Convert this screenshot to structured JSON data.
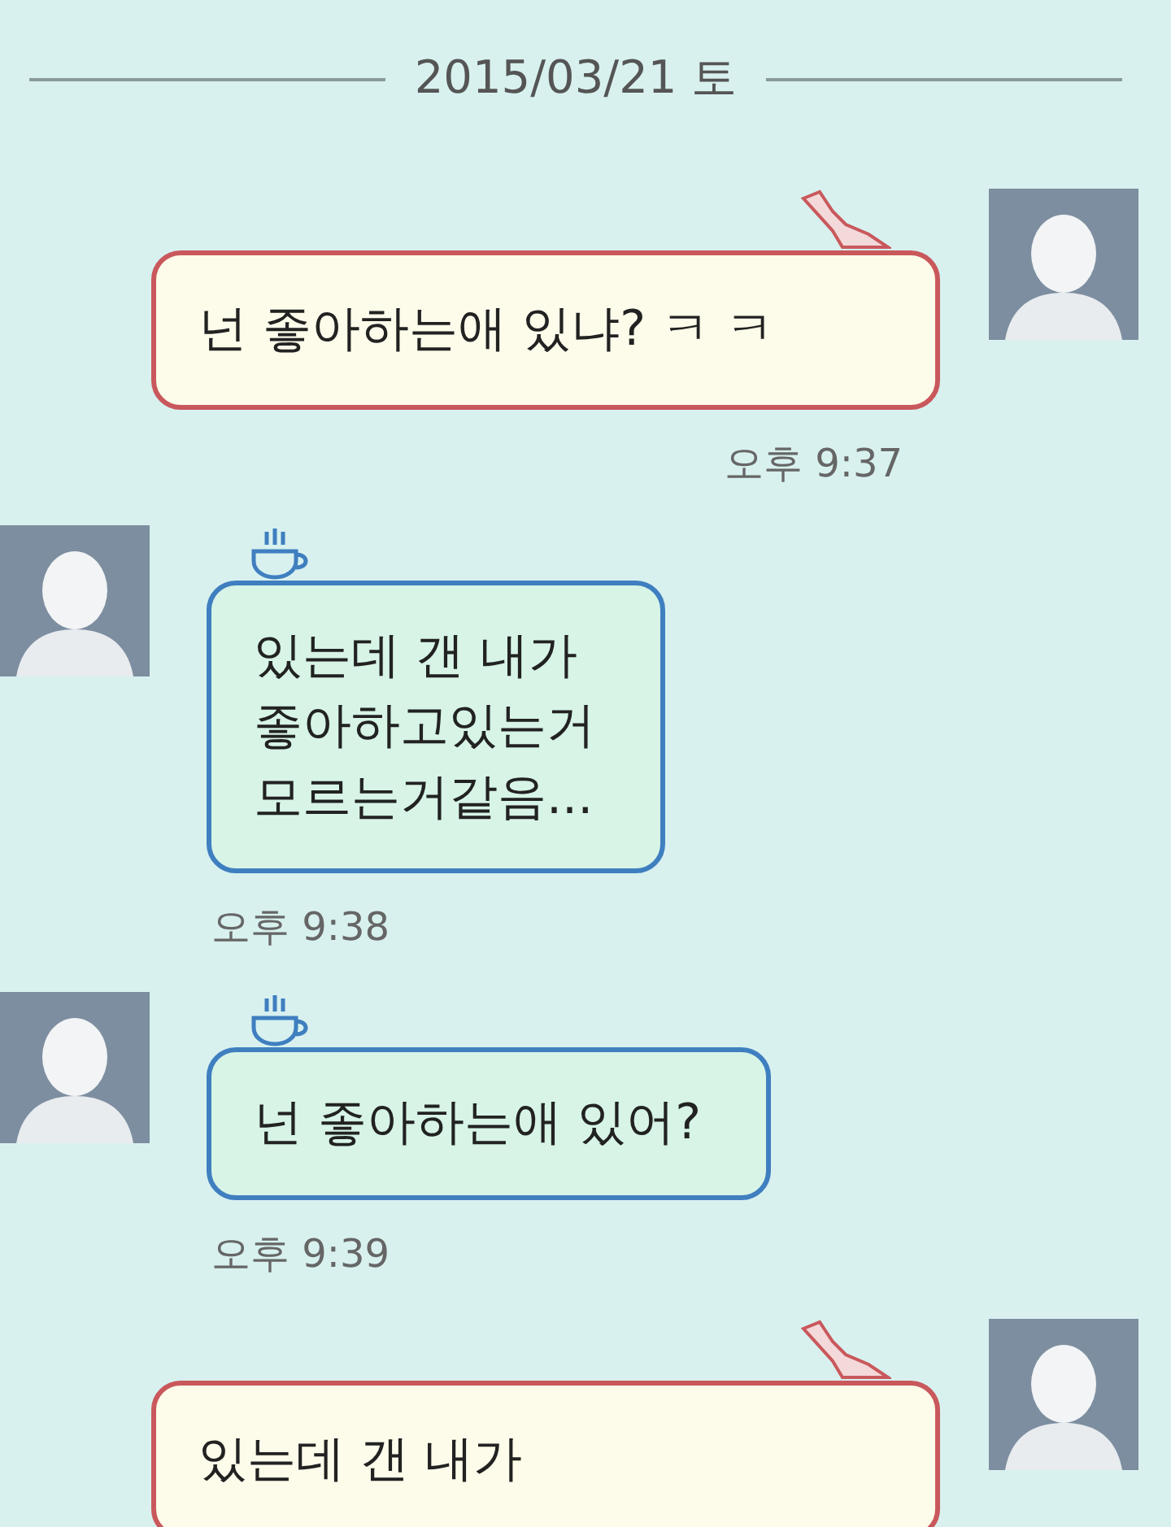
{
  "date_divider": "2015/03/21 토",
  "messages": [
    {
      "kind": "outgoing",
      "text": "넌 좋아하는애 있냐? ㅋ ㅋ",
      "time": "오후 9:37"
    },
    {
      "kind": "incoming",
      "text": "있는데 갠 내가\n좋아하고있는거\n모르는거같음...",
      "time": "오후 9:38"
    },
    {
      "kind": "incoming",
      "text": "넌 좋아하는애 있어?",
      "time": "오후 9:39"
    },
    {
      "kind": "outgoing",
      "text": "있는데 갠 내가"
    }
  ]
}
